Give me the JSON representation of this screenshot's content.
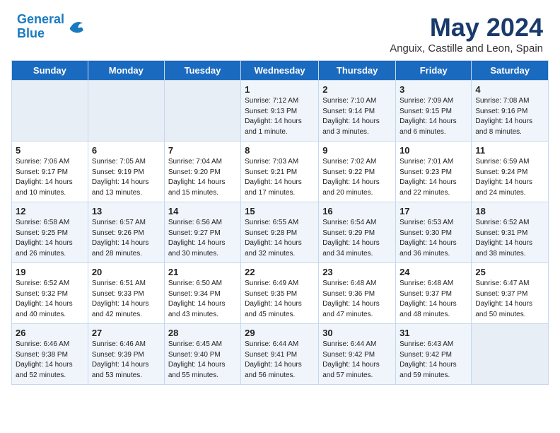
{
  "header": {
    "logo_line1": "General",
    "logo_line2": "Blue",
    "main_title": "May 2024",
    "subtitle": "Anguix, Castille and Leon, Spain"
  },
  "columns": [
    "Sunday",
    "Monday",
    "Tuesday",
    "Wednesday",
    "Thursday",
    "Friday",
    "Saturday"
  ],
  "weeks": [
    [
      {
        "day": "",
        "content": ""
      },
      {
        "day": "",
        "content": ""
      },
      {
        "day": "",
        "content": ""
      },
      {
        "day": "1",
        "content": "Sunrise: 7:12 AM\nSunset: 9:13 PM\nDaylight: 14 hours\nand 1 minute."
      },
      {
        "day": "2",
        "content": "Sunrise: 7:10 AM\nSunset: 9:14 PM\nDaylight: 14 hours\nand 3 minutes."
      },
      {
        "day": "3",
        "content": "Sunrise: 7:09 AM\nSunset: 9:15 PM\nDaylight: 14 hours\nand 6 minutes."
      },
      {
        "day": "4",
        "content": "Sunrise: 7:08 AM\nSunset: 9:16 PM\nDaylight: 14 hours\nand 8 minutes."
      }
    ],
    [
      {
        "day": "5",
        "content": "Sunrise: 7:06 AM\nSunset: 9:17 PM\nDaylight: 14 hours\nand 10 minutes."
      },
      {
        "day": "6",
        "content": "Sunrise: 7:05 AM\nSunset: 9:19 PM\nDaylight: 14 hours\nand 13 minutes."
      },
      {
        "day": "7",
        "content": "Sunrise: 7:04 AM\nSunset: 9:20 PM\nDaylight: 14 hours\nand 15 minutes."
      },
      {
        "day": "8",
        "content": "Sunrise: 7:03 AM\nSunset: 9:21 PM\nDaylight: 14 hours\nand 17 minutes."
      },
      {
        "day": "9",
        "content": "Sunrise: 7:02 AM\nSunset: 9:22 PM\nDaylight: 14 hours\nand 20 minutes."
      },
      {
        "day": "10",
        "content": "Sunrise: 7:01 AM\nSunset: 9:23 PM\nDaylight: 14 hours\nand 22 minutes."
      },
      {
        "day": "11",
        "content": "Sunrise: 6:59 AM\nSunset: 9:24 PM\nDaylight: 14 hours\nand 24 minutes."
      }
    ],
    [
      {
        "day": "12",
        "content": "Sunrise: 6:58 AM\nSunset: 9:25 PM\nDaylight: 14 hours\nand 26 minutes."
      },
      {
        "day": "13",
        "content": "Sunrise: 6:57 AM\nSunset: 9:26 PM\nDaylight: 14 hours\nand 28 minutes."
      },
      {
        "day": "14",
        "content": "Sunrise: 6:56 AM\nSunset: 9:27 PM\nDaylight: 14 hours\nand 30 minutes."
      },
      {
        "day": "15",
        "content": "Sunrise: 6:55 AM\nSunset: 9:28 PM\nDaylight: 14 hours\nand 32 minutes."
      },
      {
        "day": "16",
        "content": "Sunrise: 6:54 AM\nSunset: 9:29 PM\nDaylight: 14 hours\nand 34 minutes."
      },
      {
        "day": "17",
        "content": "Sunrise: 6:53 AM\nSunset: 9:30 PM\nDaylight: 14 hours\nand 36 minutes."
      },
      {
        "day": "18",
        "content": "Sunrise: 6:52 AM\nSunset: 9:31 PM\nDaylight: 14 hours\nand 38 minutes."
      }
    ],
    [
      {
        "day": "19",
        "content": "Sunrise: 6:52 AM\nSunset: 9:32 PM\nDaylight: 14 hours\nand 40 minutes."
      },
      {
        "day": "20",
        "content": "Sunrise: 6:51 AM\nSunset: 9:33 PM\nDaylight: 14 hours\nand 42 minutes."
      },
      {
        "day": "21",
        "content": "Sunrise: 6:50 AM\nSunset: 9:34 PM\nDaylight: 14 hours\nand 43 minutes."
      },
      {
        "day": "22",
        "content": "Sunrise: 6:49 AM\nSunset: 9:35 PM\nDaylight: 14 hours\nand 45 minutes."
      },
      {
        "day": "23",
        "content": "Sunrise: 6:48 AM\nSunset: 9:36 PM\nDaylight: 14 hours\nand 47 minutes."
      },
      {
        "day": "24",
        "content": "Sunrise: 6:48 AM\nSunset: 9:37 PM\nDaylight: 14 hours\nand 48 minutes."
      },
      {
        "day": "25",
        "content": "Sunrise: 6:47 AM\nSunset: 9:37 PM\nDaylight: 14 hours\nand 50 minutes."
      }
    ],
    [
      {
        "day": "26",
        "content": "Sunrise: 6:46 AM\nSunset: 9:38 PM\nDaylight: 14 hours\nand 52 minutes."
      },
      {
        "day": "27",
        "content": "Sunrise: 6:46 AM\nSunset: 9:39 PM\nDaylight: 14 hours\nand 53 minutes."
      },
      {
        "day": "28",
        "content": "Sunrise: 6:45 AM\nSunset: 9:40 PM\nDaylight: 14 hours\nand 55 minutes."
      },
      {
        "day": "29",
        "content": "Sunrise: 6:44 AM\nSunset: 9:41 PM\nDaylight: 14 hours\nand 56 minutes."
      },
      {
        "day": "30",
        "content": "Sunrise: 6:44 AM\nSunset: 9:42 PM\nDaylight: 14 hours\nand 57 minutes."
      },
      {
        "day": "31",
        "content": "Sunrise: 6:43 AM\nSunset: 9:42 PM\nDaylight: 14 hours\nand 59 minutes."
      },
      {
        "day": "",
        "content": ""
      }
    ]
  ]
}
